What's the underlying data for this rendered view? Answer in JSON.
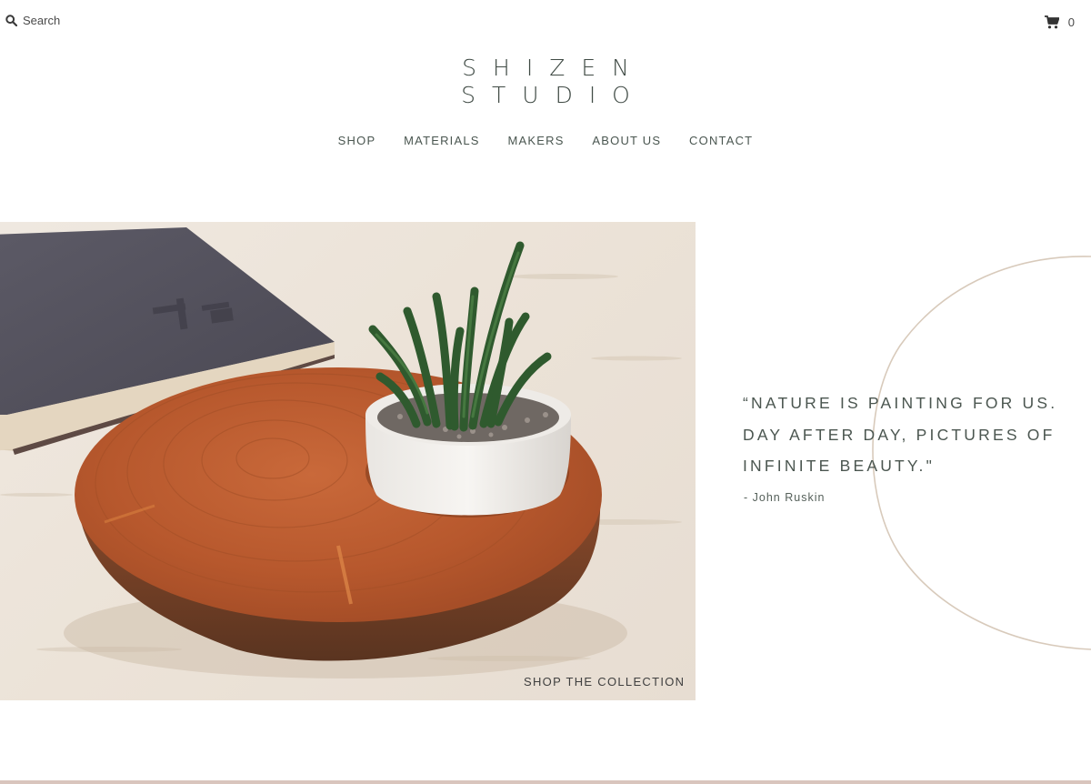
{
  "header": {
    "search_label": "Search",
    "search_icon": "search-icon",
    "cart_icon": "cart-icon",
    "cart_count": "0"
  },
  "logo": {
    "line1": "SHIZEN",
    "line2": "STUDIO"
  },
  "nav": {
    "items": [
      {
        "label": "SHOP"
      },
      {
        "label": "MATERIALS"
      },
      {
        "label": "MAKERS"
      },
      {
        "label": "ABOUT US"
      },
      {
        "label": "CONTACT"
      }
    ]
  },
  "hero": {
    "cta_label": "SHOP THE COLLECTION"
  },
  "quote": {
    "lines": [
      "“NATURE IS PAINTING FOR US.",
      "DAY AFTER DAY, PICTURES OF",
      "INFINITE BEAUTY.\""
    ],
    "author": "- John Ruskin"
  },
  "colors": {
    "text": "#3b4540",
    "accent_line": "#d8cabb",
    "bottom_rule": "#d9c5bd"
  }
}
